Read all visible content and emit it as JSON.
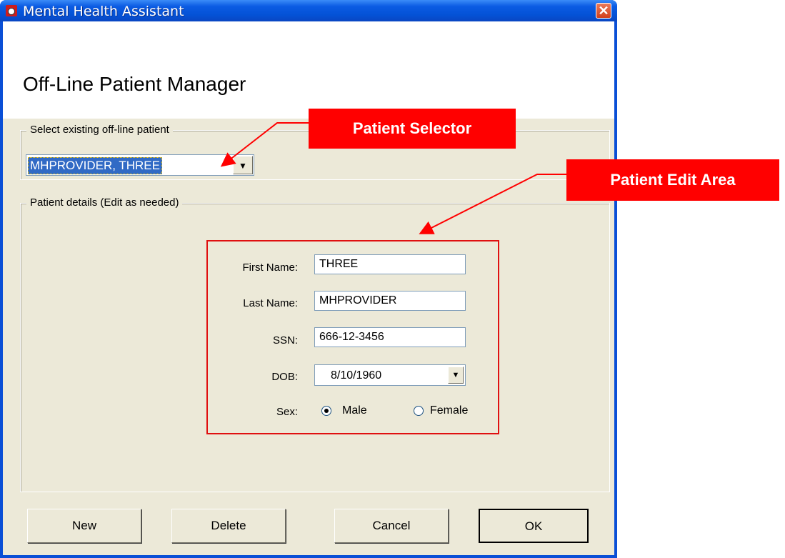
{
  "window": {
    "title": "Mental Health Assistant",
    "close_glyph": "✕"
  },
  "page_title": "Off-Line Patient Manager",
  "selector_group": {
    "label": "Select existing off-line patient",
    "selected_patient": "MHPROVIDER, THREE"
  },
  "details_group": {
    "label": "Patient details  (Edit as needed)",
    "first_name_label": "First Name:",
    "first_name_value": "THREE",
    "last_name_label": "Last Name:",
    "last_name_value": "MHPROVIDER",
    "ssn_label": "SSN:",
    "ssn_value": "666-12-3456",
    "dob_label": "DOB:",
    "dob_value": "8/10/1960",
    "sex_label": "Sex:",
    "sex_options": [
      {
        "label": "Male",
        "selected": true
      },
      {
        "label": "Female",
        "selected": false
      }
    ]
  },
  "buttons": {
    "new": "New",
    "delete": "Delete",
    "cancel": "Cancel",
    "ok": "OK"
  },
  "annotations": {
    "selector": "Patient Selector",
    "edit_area": "Patient Edit Area",
    "color": "#ff0000"
  }
}
